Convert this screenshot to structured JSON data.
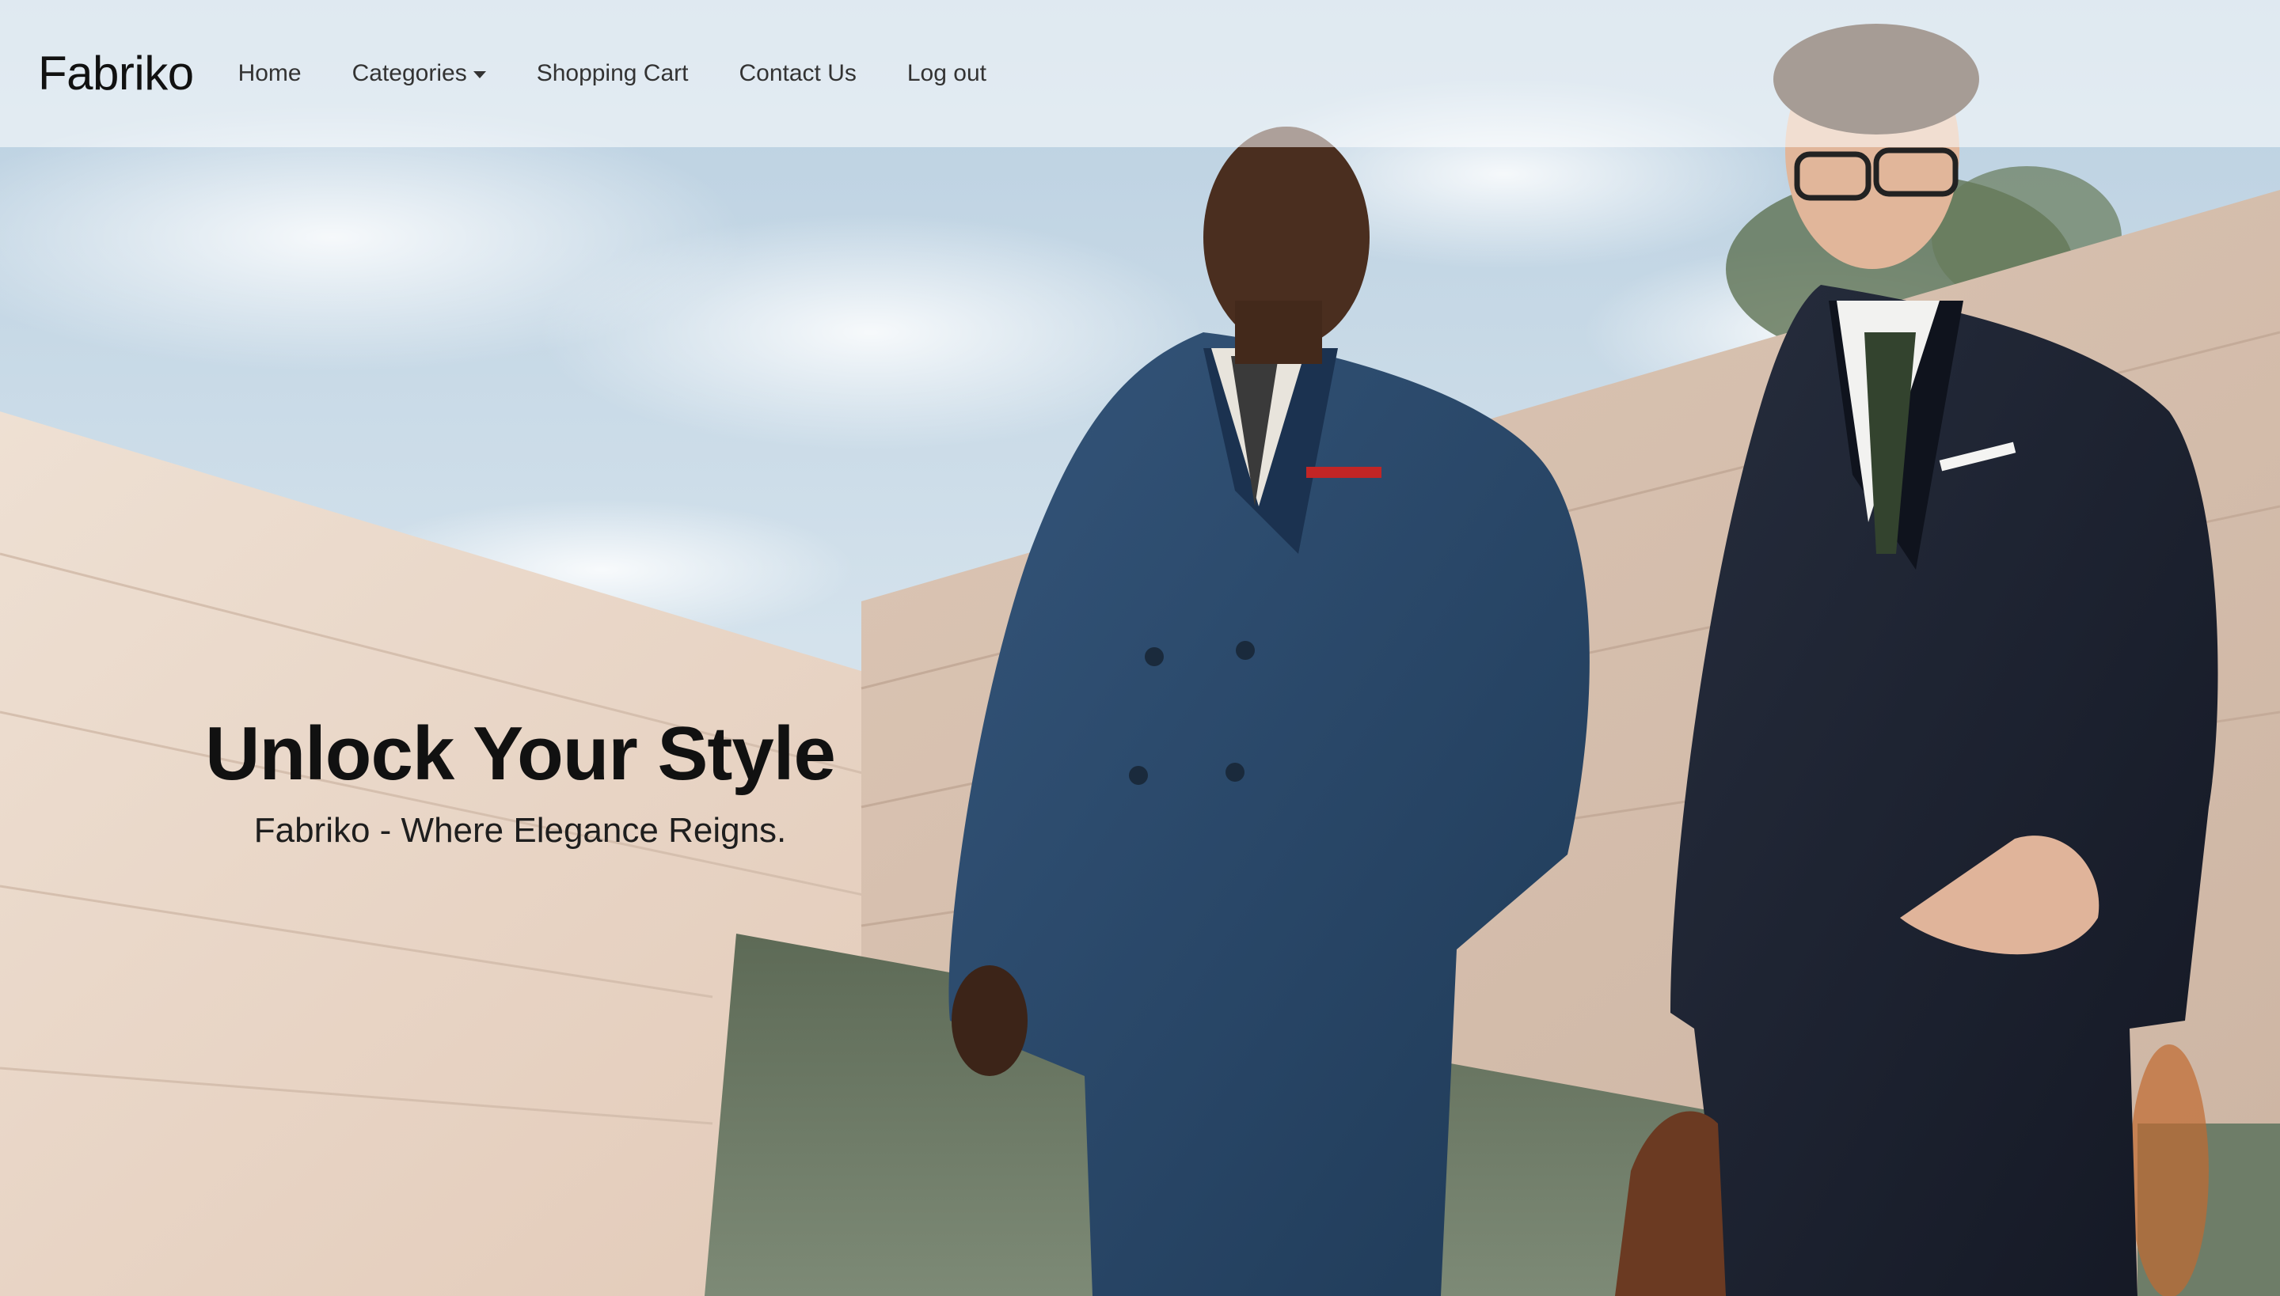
{
  "navbar": {
    "brand": "Fabriko",
    "items": [
      {
        "label": "Home"
      },
      {
        "label": "Categories",
        "has_dropdown": true
      },
      {
        "label": "Shopping Cart"
      },
      {
        "label": "Contact Us"
      },
      {
        "label": "Log out"
      }
    ]
  },
  "hero": {
    "title": "Unlock Your Style",
    "subtitle": "Fabriko - Where Elegance Reigns."
  },
  "colors": {
    "navbar_bg": "#ffffffcc",
    "text_dark": "#111111",
    "suit_blue": "#2d4a6b",
    "suit_navy": "#1c2230",
    "wall": "#e6d2c2",
    "sky": "#cfe0ec"
  },
  "icons": {
    "dropdown": "caret-down-icon"
  }
}
